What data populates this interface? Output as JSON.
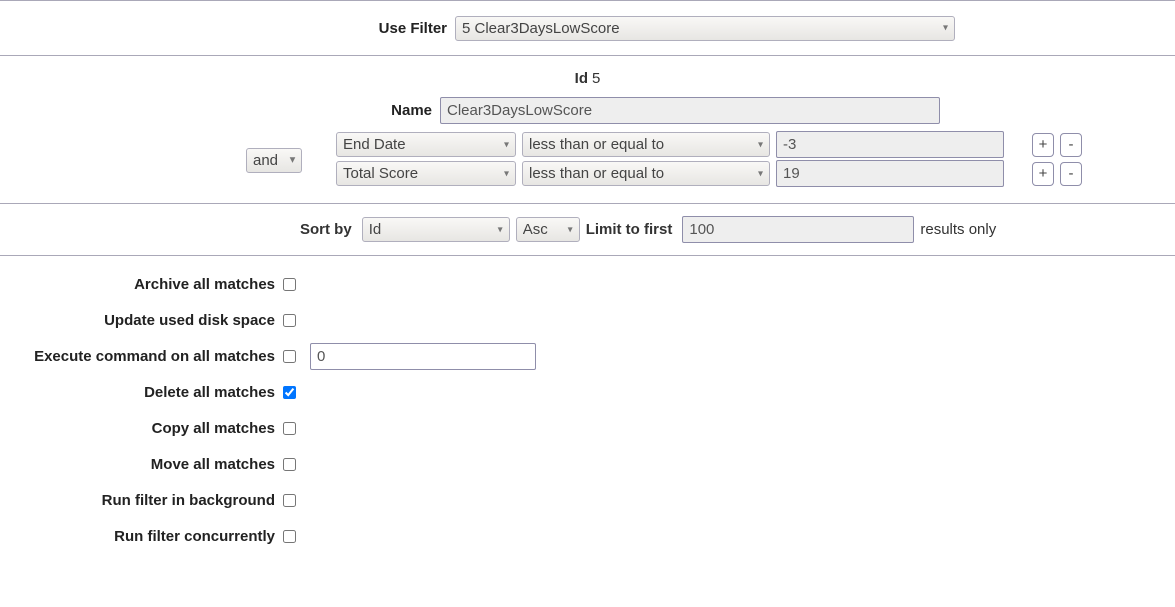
{
  "useFilter": {
    "label": "Use Filter",
    "selected": "5 Clear3DaysLowScore"
  },
  "idRow": {
    "label": "Id",
    "value": "5"
  },
  "nameRow": {
    "label": "Name",
    "value": "Clear3DaysLowScore"
  },
  "logic": {
    "selected": "and"
  },
  "rules": [
    {
      "field": "End Date",
      "op": "less than or equal to",
      "value": "-3"
    },
    {
      "field": "Total Score",
      "op": "less than or equal to",
      "value": "19"
    }
  ],
  "ruleButtons": {
    "add": "+",
    "remove": "-"
  },
  "sort": {
    "label": "Sort by",
    "field": "Id",
    "dir": "Asc",
    "limitLabel": "Limit to first",
    "limitValue": "100",
    "suffix": "results only"
  },
  "options": {
    "archive": {
      "label": "Archive all matches",
      "checked": false
    },
    "updateDisk": {
      "label": "Update used disk space",
      "checked": false
    },
    "execCmd": {
      "label": "Execute command on all matches",
      "checked": false,
      "cmdValue": "0"
    },
    "deleteAll": {
      "label": "Delete all matches",
      "checked": true
    },
    "copyAll": {
      "label": "Copy all matches",
      "checked": false
    },
    "moveAll": {
      "label": "Move all matches",
      "checked": false
    },
    "runBackground": {
      "label": "Run filter in background",
      "checked": false
    },
    "runConcurrent": {
      "label": "Run filter concurrently",
      "checked": false
    }
  }
}
